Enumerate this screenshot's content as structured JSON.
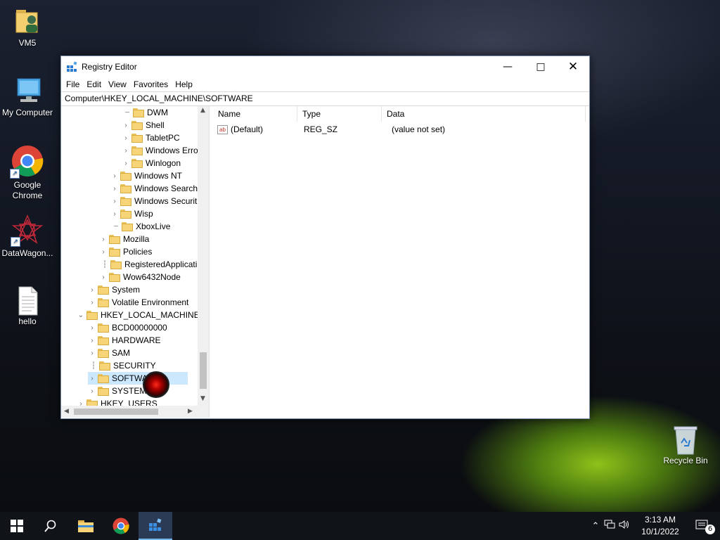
{
  "desktop": {
    "icons": [
      {
        "label": "VM5"
      },
      {
        "label": "My Computer"
      },
      {
        "label": "Google Chrome"
      },
      {
        "label": "DataWagon..."
      },
      {
        "label": "hello"
      },
      {
        "label": "Recycle Bin"
      }
    ]
  },
  "window": {
    "title": "Registry Editor",
    "menu": [
      "File",
      "Edit",
      "View",
      "Favorites",
      "Help"
    ],
    "address": "Computer\\HKEY_LOCAL_MACHINE\\SOFTWARE",
    "tree": [
      {
        "label": "DWM"
      },
      {
        "label": "Shell"
      },
      {
        "label": "TabletPC"
      },
      {
        "label": "Windows Erro"
      },
      {
        "label": "Winlogon"
      },
      {
        "label": "Windows NT"
      },
      {
        "label": "Windows Search"
      },
      {
        "label": "Windows Securit"
      },
      {
        "label": "Wisp"
      },
      {
        "label": "XboxLive"
      },
      {
        "label": "Mozilla"
      },
      {
        "label": "Policies"
      },
      {
        "label": "RegisteredApplicati"
      },
      {
        "label": "Wow6432Node"
      },
      {
        "label": "System"
      },
      {
        "label": "Volatile Environment"
      },
      {
        "label": "HKEY_LOCAL_MACHINE"
      },
      {
        "label": "BCD00000000"
      },
      {
        "label": "HARDWARE"
      },
      {
        "label": "SAM"
      },
      {
        "label": "SECURITY"
      },
      {
        "label": "SOFTWARE"
      },
      {
        "label": "SYSTEM"
      },
      {
        "label": "HKEY_USERS"
      }
    ],
    "columns": [
      "Name",
      "Type",
      "Data"
    ],
    "values": [
      {
        "name": "(Default)",
        "type": "REG_SZ",
        "data": "(value not set)"
      }
    ]
  },
  "taskbar": {
    "time": "3:13 AM",
    "date": "10/1/2022",
    "notification_count": "6"
  }
}
